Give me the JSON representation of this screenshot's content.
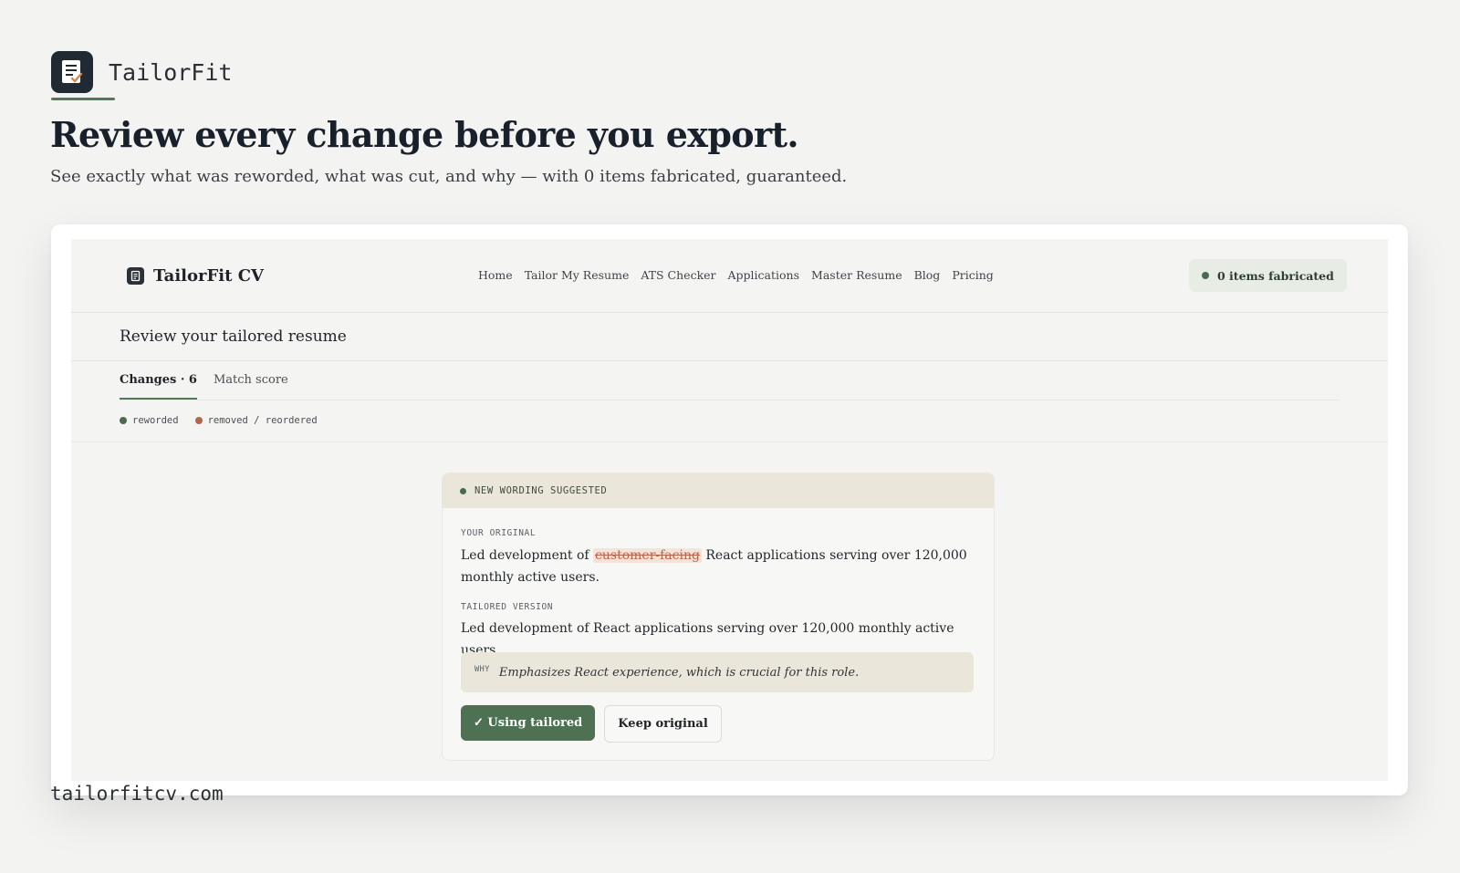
{
  "brand": {
    "name": "TailorFit"
  },
  "hero": {
    "headline": "Review every change before you export.",
    "subline": "See exactly what was reworded, what was cut, and why — with 0 items fabricated, guaranteed."
  },
  "app": {
    "logo_text": "TailorFit CV",
    "nav": [
      "Home",
      "Tailor My Resume",
      "ATS Checker",
      "Applications",
      "Master Resume",
      "Blog",
      "Pricing"
    ],
    "fabricated_badge": "0 items fabricated",
    "page_title": "Review your tailored resume",
    "tabs": [
      "Changes · 6",
      "Match score"
    ],
    "legend": [
      {
        "label": "reworded",
        "color": "#4b6b50"
      },
      {
        "label": "removed / reordered",
        "color": "#b5654a"
      }
    ],
    "card": {
      "header": "NEW WORDING SUGGESTED",
      "original_label": "YOUR ORIGINAL",
      "original_before": "Led development of ",
      "original_removed": "customer-facing",
      "original_after": " React applications serving over 120,000 monthly active users.",
      "tailored_label": "TAILORED VERSION",
      "tailored_text": "Led development of React applications serving over 120,000 monthly active users.",
      "why_label": "WHY",
      "why_text": "Emphasizes React experience, which is crucial for this role.",
      "btn_use": "✓ Using tailored",
      "btn_keep": "Keep original"
    }
  },
  "footer": {
    "url": "tailorfitcv.com"
  }
}
